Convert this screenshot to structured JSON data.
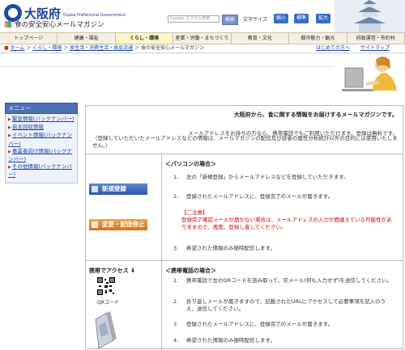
{
  "header": {
    "logo_jp": "大阪府",
    "logo_en": "Osaka Prefectural Government",
    "search_placeholder": "Google カスタム検索",
    "search_button": "検索",
    "font_size_label": "文字サイズ",
    "font_buttons": [
      "縮小",
      "標準",
      "拡大"
    ]
  },
  "nav": {
    "tabs": [
      "トップページ",
      "健康・福祉",
      "くらし・環境",
      "産業・労働・まちづくり",
      "教育・文化",
      "都市魅力・観光",
      "府政運営・市町村"
    ]
  },
  "breadcrumb": {
    "home": "ホーム",
    "items": [
      "くらし・環境",
      "食生活・消費生活・食品流通"
    ],
    "current": "食の安全安心メールマガジン",
    "first_visit": "はじめての方へ",
    "sitemap": "サイトマップ"
  },
  "page": {
    "title": "食の安全安心メールマガジン"
  },
  "sidebar": {
    "header": "メニュー",
    "items": [
      "緊急情報(バックナンバー)",
      "自主回収情報",
      "イベント情報(バックナンバー)",
      "事業者向け情報(バックナンバー)",
      "その他情報(バックナンバー)"
    ]
  },
  "main": {
    "intro_bold": "大阪府から、食に関する情報をお届けするメールマガジンです。",
    "intro_line1": "メールアドレスをお持ちの方なら、携帯電話でもご利用いただけます。登録は無料です。",
    "intro_line2": "（登録していただいたメールアドレスなどの情報は、メールマガジンの配信及び読者の属性分析統計以外の目的には使用いたしません。）",
    "pc": {
      "heading": "＜パソコンの場合＞",
      "register_label": "新規登録",
      "change_label": "変更・配信停止",
      "steps": [
        {
          "n": "1.",
          "text": "左の「新規登録」からメールアドレスなどを登録していただきます。"
        },
        {
          "n": "2.",
          "text": "登録されたメールアドレスに、登録完了のメールが届きます。"
        },
        {
          "n": "3.",
          "text": "希望された情報のみ随時配信します。"
        }
      ],
      "caution_title": "【ご注意】",
      "caution_text": "登録完了確認メールが届かない場合は、メールアドレスの入力が間違えている可能性がありますので、再度、登録し直してください。"
    },
    "mobile": {
      "access_label": "携帯でアクセス ⬇",
      "qr_label": "QRコード",
      "heading": "＜携帯電話の場合＞",
      "steps": [
        {
          "n": "1.",
          "text": "携帯電話で左のQRコードを読み取って、空メール(何も入力せず)を送信してください。"
        },
        {
          "n": "2.",
          "text": "折り返しメールが届きますので、記載されたURLにアクセスして必要事項を記入のうえ、送信してください。"
        },
        {
          "n": "3.",
          "text": "登録されたメールアドレスに、登録完了のメールが届きます。"
        },
        {
          "n": "4.",
          "text": "希望された情報のみ随時配信します。"
        }
      ]
    }
  }
}
